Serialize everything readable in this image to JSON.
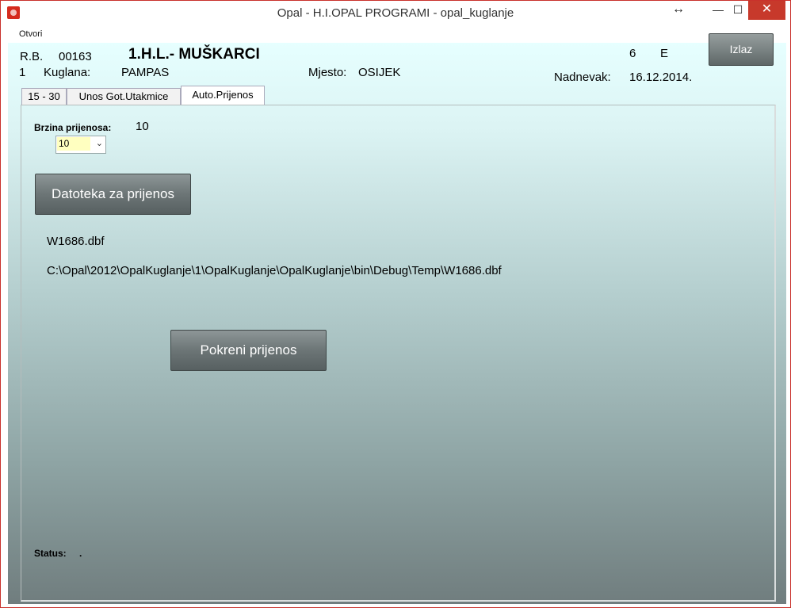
{
  "window": {
    "title": "Opal - H.I.OPAL PROGRAMI - opal_kuglanje"
  },
  "controls": {
    "resize": "↔",
    "minimize": "—",
    "maximize": "☐",
    "close": "✕"
  },
  "menu": {
    "items": [
      "Otvori"
    ]
  },
  "header": {
    "rb_label": "R.B.",
    "rb_value": "00163",
    "league": "1.H.L.- MUŠKARCI",
    "num": "6",
    "letter": "E",
    "exit_label": "Izlaz",
    "row_no": "1",
    "kuglana_label": "Kuglana:",
    "kuglana_value": "PAMPAS",
    "mjesto_label": "Mjesto:",
    "mjesto_value": "OSIJEK",
    "nadnevak_label": "Nadnevak:",
    "nadnevak_value": "16.12.2014."
  },
  "tabs": [
    {
      "label": "15 - 30",
      "active": false
    },
    {
      "label": "Unos Got.Utakmice",
      "active": false
    },
    {
      "label": "Auto.Prijenos",
      "active": true
    }
  ],
  "transfer": {
    "speed_label": "Brzina prijenosa:",
    "speed_value": "10",
    "speed_select": "10",
    "file_button": "Datoteka za prijenos",
    "file_name": "W1686.dbf",
    "file_path": "C:\\Opal\\2012\\OpalKuglanje\\1\\OpalKuglanje\\OpalKuglanje\\bin\\Debug\\Temp\\W1686.dbf",
    "start_button": "Pokreni prijenos",
    "status_label": "Status:",
    "status_value": "."
  },
  "colors": {
    "close": "#c7392b",
    "accent_icon": "#d52b1e",
    "select_bg": "#ffffc0"
  }
}
